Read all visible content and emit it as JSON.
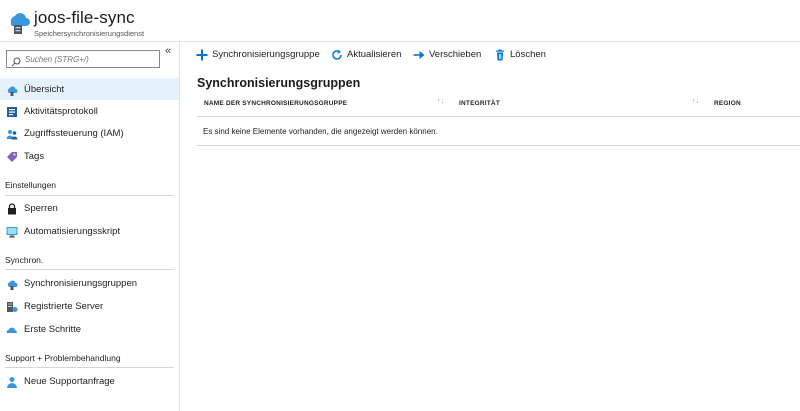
{
  "header": {
    "title": "joos-file-sync",
    "subtitle": "Speichersynchronisierungsdienst",
    "icon": "storage-sync-cloud-icon"
  },
  "sidebar": {
    "search_placeholder": "Suchen (STRG+/)",
    "collapse_label": "«",
    "items": [
      {
        "label": "Übersicht",
        "icon": "cloud-sync-icon",
        "active": true
      },
      {
        "label": "Aktivitätsprotokoll",
        "icon": "activity-log-icon"
      },
      {
        "label": "Zugriffssteuerung (IAM)",
        "icon": "users-iam-icon"
      },
      {
        "label": "Tags",
        "icon": "tag-icon"
      }
    ],
    "sections": [
      {
        "title": "Einstellungen",
        "items": [
          {
            "label": "Sperren",
            "icon": "lock-icon"
          },
          {
            "label": "Automatisierungsskript",
            "icon": "script-monitor-icon"
          }
        ]
      },
      {
        "title": "Synchron.",
        "items": [
          {
            "label": "Synchronisierungsgruppen",
            "icon": "cloud-sync-icon"
          },
          {
            "label": "Registrierte Server",
            "icon": "server-icon"
          },
          {
            "label": "Erste Schritte",
            "icon": "cloud-start-icon"
          }
        ]
      },
      {
        "title": "Support + Problembehandlung",
        "items": [
          {
            "label": "Neue Supportanfrage",
            "icon": "support-person-icon"
          }
        ]
      }
    ]
  },
  "toolbar": {
    "add_label": "Synchronisierungsgruppe",
    "refresh_label": "Aktualisieren",
    "move_label": "Verschieben",
    "delete_label": "Löschen"
  },
  "main": {
    "title": "Synchronisierungsgruppen",
    "columns": [
      "NAME DER SYNCHRONISIERUNGSGRUPPE",
      "INTEGRITÄT",
      "REGION"
    ],
    "empty_message": "Es sind keine Elemente vorhanden, die angezeigt werden können."
  },
  "colors": {
    "accent": "#0078d4",
    "active_bg": "#e5f1fb",
    "tag": "#8661c5",
    "cloud": "#3a96dd"
  }
}
